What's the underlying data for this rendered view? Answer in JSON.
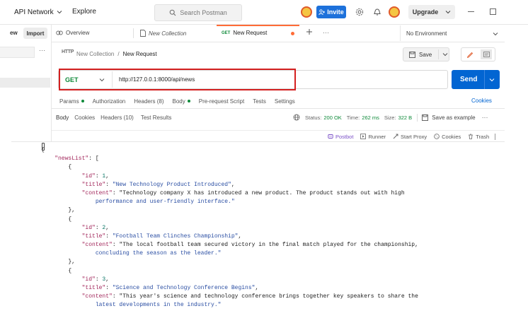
{
  "topbar": {
    "workspace": "API Network",
    "explore": "Explore",
    "search_placeholder": "Search Postman",
    "invite": "Invite",
    "upgrade": "Upgrade"
  },
  "left_panel": {
    "new_label": "ew",
    "import_label": "Import"
  },
  "tabs": {
    "overview": "Overview",
    "new_collection": "New Collection",
    "active_method": "GET",
    "active_title": "New Request",
    "environment": "No Environment"
  },
  "breadcrumb": {
    "collection": "New Collection",
    "separator": "/",
    "request": "New Request"
  },
  "save_label": "Save",
  "request": {
    "method": "GET",
    "url": "http://127.0.0.1:8000/api/news",
    "send_label": "Send"
  },
  "request_tabs": {
    "params": "Params",
    "authorization": "Authorization",
    "headers": "Headers (8)",
    "body": "Body",
    "pre_request": "Pre-request Script",
    "tests": "Tests",
    "settings": "Settings",
    "cookies": "Cookies"
  },
  "response_tabs": {
    "body": "Body",
    "cookies": "Cookies",
    "headers": "Headers (10)",
    "test_results": "Test Results",
    "status_label": "Status:",
    "status_value": "200 OK",
    "time_label": "Time:",
    "time_value": "262 ms",
    "size_label": "Size:",
    "size_value": "322 B",
    "save_example": "Save as example"
  },
  "statusbar": {
    "postbot": "Postbot",
    "runner": "Runner",
    "start_proxy": "Start Proxy",
    "cookies": "Cookies",
    "trash": "Trash"
  },
  "response_lines": [
    "{",
    "    \"newsList\": [",
    "        {",
    "            \"id\": 1,",
    "            \"title\": \"New Technology Product Introduced\",",
    "            \"content\": \"Technology company X has introduced a new product. The product stands out with high",
    "                performance and user-friendly interface.\"",
    "        },",
    "        {",
    "            \"id\": 2,",
    "            \"title\": \"Football Team Clinches Championship\",",
    "            \"content\": \"The local football team secured victory in the final match played for the championship,",
    "                concluding the season as the leader.\"",
    "        },",
    "        {",
    "            \"id\": 3,",
    "            \"title\": \"Science and Technology Conference Begins\",",
    "            \"content\": \"This year's science and technology conference brings together key speakers to share the",
    "                latest developments in the industry.\""
  ],
  "colors": {
    "accent_blue": "#0265d2",
    "invite_blue": "#1d71db",
    "method_green": "#0f8a3a",
    "highlight_red": "#d42020",
    "orange_dot": "#ff6c37",
    "json_key": "#a2275b",
    "json_string": "#2a4ea3",
    "json_number": "#0f7a6a"
  }
}
